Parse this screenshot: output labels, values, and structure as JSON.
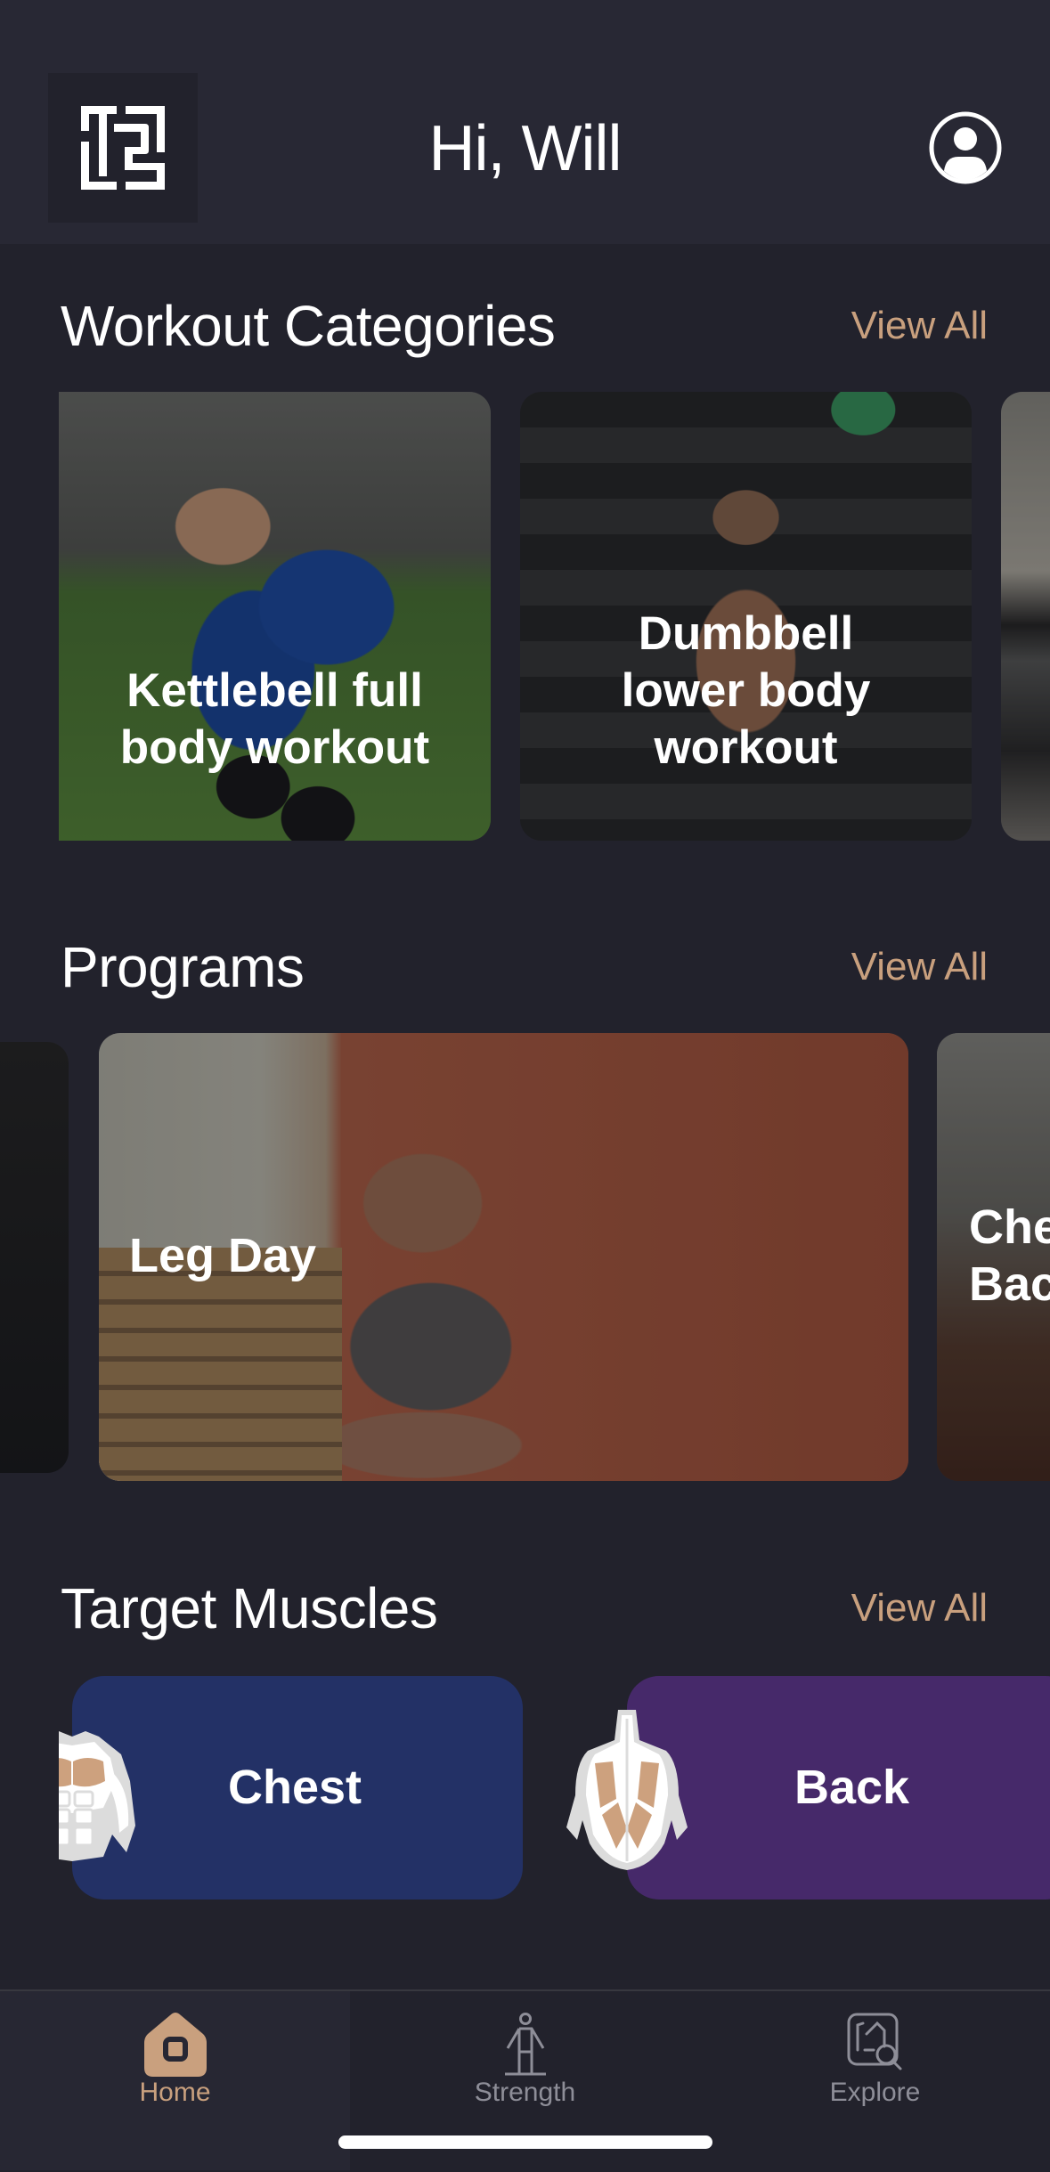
{
  "header": {
    "greeting": "Hi, Will",
    "logo_icon": "brand-logo-12",
    "profile_icon": "user-circle-icon"
  },
  "colors": {
    "background": "#22222c",
    "header_background": "#282834",
    "accent": "#c9a07e",
    "chest_card": "#233166",
    "back_card": "#46296a",
    "inactive_tab": "#8e8e98"
  },
  "sections": {
    "workout_categories": {
      "title": "Workout Categories",
      "view_all": "View All",
      "cards": [
        {
          "title": "Kettlebell full body workout",
          "lines": [
            "Kettlebell full",
            "body workout"
          ]
        },
        {
          "title": "Dumbbell lower body workout",
          "lines": [
            "Dumbbell",
            "lower body",
            "workout"
          ]
        },
        {
          "title": "",
          "lines": []
        }
      ]
    },
    "programs": {
      "title": "Programs",
      "view_all": "View All",
      "cards": [
        {
          "title": "",
          "lines": []
        },
        {
          "title": "Leg Day",
          "lines": [
            "Leg Day"
          ]
        },
        {
          "title": "Che… Bac…",
          "lines": [
            "Che",
            "Bac"
          ]
        }
      ]
    },
    "target_muscles": {
      "title": "Target Muscles",
      "view_all": "View All",
      "cards": [
        {
          "label": "Chest",
          "icon": "chest-muscle-icon"
        },
        {
          "label": "Back",
          "icon": "back-muscle-icon"
        }
      ]
    }
  },
  "nav": {
    "tabs": [
      {
        "label": "Home",
        "icon": "home-icon",
        "active": true
      },
      {
        "label": "Strength",
        "icon": "body-figure-icon",
        "active": false
      },
      {
        "label": "Explore",
        "icon": "explore-search-icon",
        "active": false
      }
    ]
  }
}
